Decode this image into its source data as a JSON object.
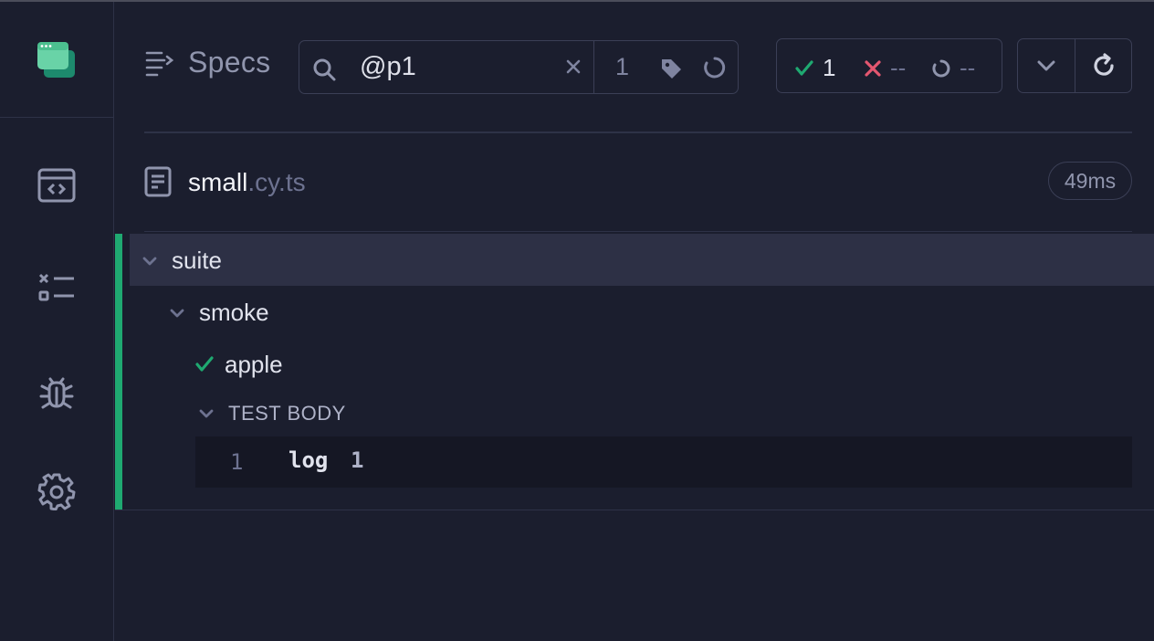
{
  "header": {
    "title": "Specs",
    "search_value": "@p1",
    "search_placeholder": "",
    "match_count": "1"
  },
  "stats": {
    "passed": "1",
    "failed": "--",
    "pending": "--"
  },
  "spec": {
    "file_base": "small",
    "file_ext": ".cy.ts",
    "duration": "49ms"
  },
  "tree": {
    "suite": "suite",
    "subsuite": "smoke",
    "test": "apple",
    "section": "TEST BODY",
    "command": {
      "number": "1",
      "name": "log",
      "message": "1"
    }
  },
  "colors": {
    "background": "#1b1e2e",
    "pass": "#1fa971",
    "fail": "#e45770",
    "brand": "#69d3a7"
  },
  "icons": {
    "sidebar": [
      "specs-icon",
      "runs-icon",
      "debug-icon",
      "settings-icon"
    ]
  }
}
